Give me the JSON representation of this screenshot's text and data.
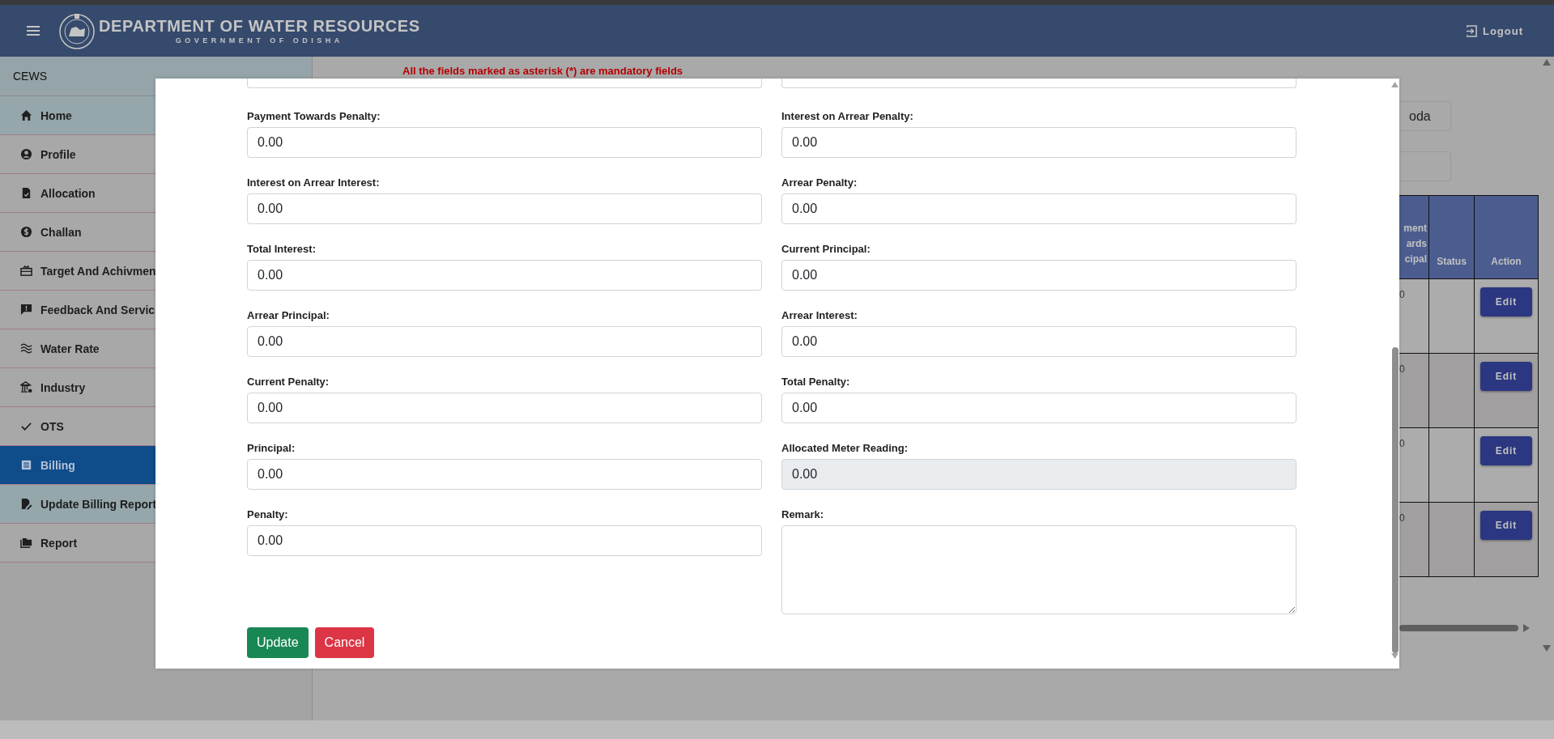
{
  "header": {
    "title": "DEPARTMENT OF WATER RESOURCES",
    "subtitle": "GOVERNMENT OF ODISHA",
    "logout": "Logout"
  },
  "sidebar": {
    "title": "CEWS",
    "items": [
      {
        "label": "Home",
        "tinted": true,
        "selected": false
      },
      {
        "label": "Profile",
        "tinted": false,
        "selected": false
      },
      {
        "label": "Allocation",
        "tinted": false,
        "selected": false
      },
      {
        "label": "Challan",
        "tinted": false,
        "selected": false
      },
      {
        "label": "Target And Achivmen",
        "tinted": false,
        "selected": false
      },
      {
        "label": "Feedback And Servic",
        "tinted": false,
        "selected": false
      },
      {
        "label": "Water Rate",
        "tinted": false,
        "selected": false
      },
      {
        "label": "Industry",
        "tinted": false,
        "selected": false
      },
      {
        "label": "OTS",
        "tinted": false,
        "selected": false
      },
      {
        "label": "Billing",
        "tinted": false,
        "selected": true
      },
      {
        "label": "Update Billing Report",
        "tinted": true,
        "selected": false
      },
      {
        "label": "Report",
        "tinted": false,
        "selected": false
      }
    ]
  },
  "notice": "All the fields marked as asterisk (*) are mandatory fields",
  "background": {
    "search_value": "oda",
    "table": {
      "columns": [
        "ment ards cipal",
        "Status",
        "Action"
      ],
      "rows": [
        {
          "column_1": "0",
          "action": "Edit"
        },
        {
          "column_1": "0",
          "action": "Edit"
        },
        {
          "column_1": "0",
          "action": "Edit"
        },
        {
          "column_1": "0",
          "action": "Edit"
        }
      ]
    }
  },
  "modal": {
    "fields": [
      {
        "label": "Payment Towards Penalty:",
        "value": "0.00",
        "kind": "input"
      },
      {
        "label": "Interest on Arrear Penalty:",
        "value": "0.00",
        "kind": "input"
      },
      {
        "label": "Interest on Arrear Interest:",
        "value": "0.00",
        "kind": "input"
      },
      {
        "label": "Arrear Penalty:",
        "value": "0.00",
        "kind": "input"
      },
      {
        "label": "Total Interest:",
        "value": "0.00",
        "kind": "input"
      },
      {
        "label": "Current Principal:",
        "value": "0.00",
        "kind": "input"
      },
      {
        "label": "Arrear Principal:",
        "value": "0.00",
        "kind": "input"
      },
      {
        "label": "Arrear Interest:",
        "value": "0.00",
        "kind": "input"
      },
      {
        "label": "Current Penalty:",
        "value": "0.00",
        "kind": "input"
      },
      {
        "label": "Total Penalty:",
        "value": "0.00",
        "kind": "input"
      },
      {
        "label": "Principal:",
        "value": "0.00",
        "kind": "input"
      },
      {
        "label": "Allocated Meter Reading:",
        "value": "0.00",
        "kind": "readonly"
      },
      {
        "label": "Penalty:",
        "value": "0.00",
        "kind": "input"
      },
      {
        "label": "Remark:",
        "kind": "textarea"
      }
    ],
    "buttons": [
      {
        "label": "Update",
        "kind": "primary"
      },
      {
        "label": "Cancel",
        "kind": "danger"
      }
    ]
  }
}
